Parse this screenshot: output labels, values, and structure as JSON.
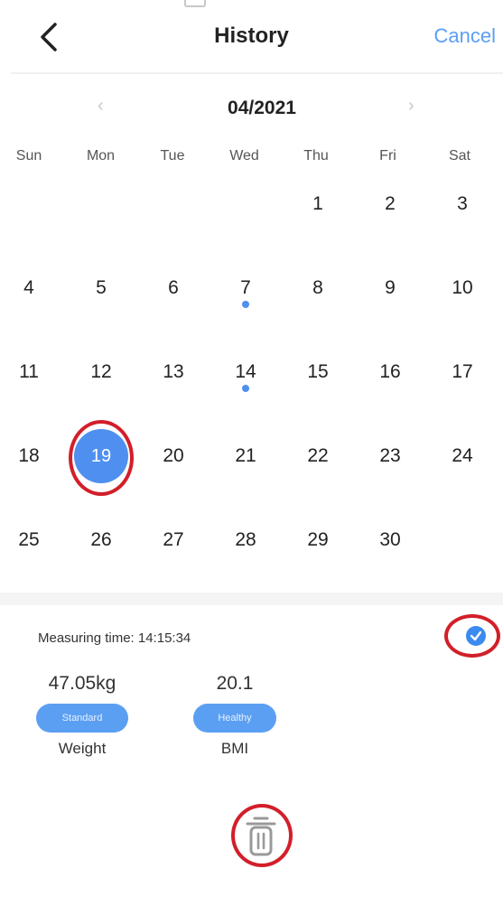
{
  "header": {
    "title": "History",
    "cancel_label": "Cancel"
  },
  "calendar": {
    "month_label": "04/2021",
    "weekdays": [
      "Sun",
      "Mon",
      "Tue",
      "Wed",
      "Thu",
      "Fri",
      "Sat"
    ],
    "first_weekday_index": 4,
    "days_in_month": 30,
    "selected_day": 19,
    "days_with_records": [
      7,
      14
    ],
    "accent_color": "#4f8fef"
  },
  "record": {
    "measuring_time_label": "Measuring time: 14:15:34",
    "checked": true,
    "metrics": [
      {
        "value": "47.05kg",
        "status": "Standard",
        "label": "Weight"
      },
      {
        "value": "20.1",
        "status": "Healthy",
        "label": "BMI"
      }
    ]
  },
  "icons": {
    "back": "chevron-left-icon",
    "prev_month": "chevron-left-icon",
    "next_month": "chevron-right-icon",
    "check": "check-circle-icon",
    "delete": "trash-icon"
  },
  "annotation_color": "#d21f2a"
}
